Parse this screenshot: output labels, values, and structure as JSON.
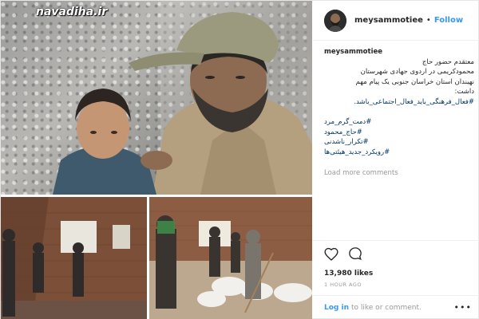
{
  "watermark": "navadiha.ir",
  "post": {
    "username": "meysammotiee",
    "follow_separator": "•",
    "follow_label": "Follow",
    "caption_user": "meysammotiee",
    "caption_lines": [
      "معتقدم حضور حاج",
      "محمودکریمی در اردوی جهادی شهرستان",
      "نهبندان استان خراسان جنوبی یک پیام مهم",
      "داشت:"
    ],
    "caption_hashtag": "#فعال_فرهنگی_باید_فعال_اجتماعی_باشد.",
    "tags": [
      "#دمت_گرم_مرد",
      "#حاج_محمود",
      "#تکرار_ناشدنی",
      "#رویکرد_جدید_هیئتی‌ها"
    ],
    "load_more": "Load more comments",
    "likes": "13,980 likes",
    "time": "1 HOUR AGO",
    "login_link": "Log in",
    "login_rest": "to like or comment.",
    "more_options": "•••"
  },
  "icons": {
    "like": "heart-icon",
    "comment": "comment-icon",
    "options": "more-options-icon"
  },
  "colors": {
    "link_blue": "#3897f0",
    "hashtag": "#003569",
    "muted": "#999999",
    "border": "#efefef"
  }
}
